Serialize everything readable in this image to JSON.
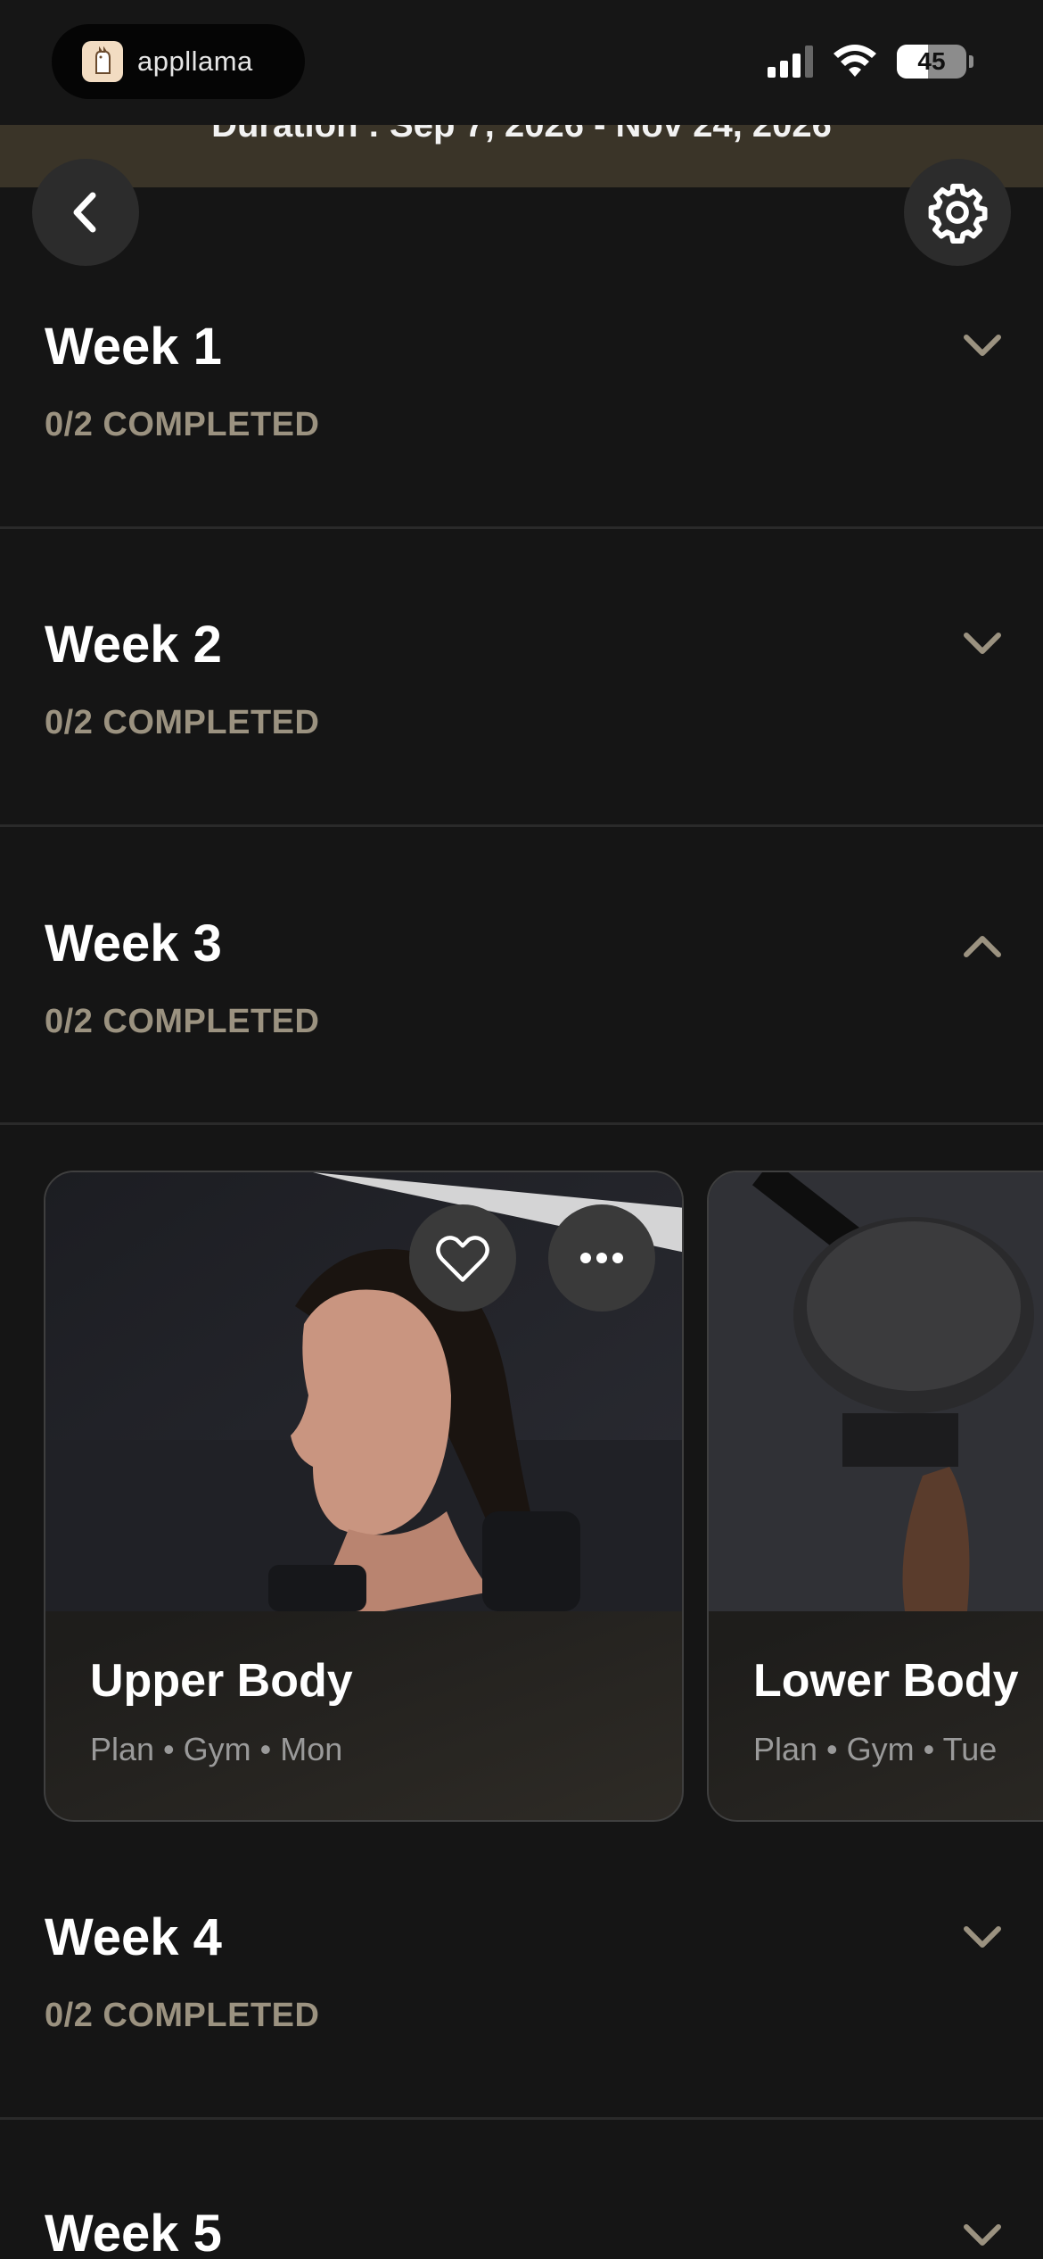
{
  "status_bar": {
    "app_name": "appllama",
    "battery": "45",
    "battery_fraction": 0.45
  },
  "header": {
    "duration": "Duration : Sep 7, 2026 - Nov 24, 2026"
  },
  "weeks": [
    {
      "title": "Week 1",
      "status": "0/2 COMPLETED",
      "expanded": false
    },
    {
      "title": "Week 2",
      "status": "0/2 COMPLETED",
      "expanded": false
    },
    {
      "title": "Week 3",
      "status": "0/2 COMPLETED",
      "expanded": true
    },
    {
      "title": "Week 4",
      "status": "0/2 COMPLETED",
      "expanded": false
    },
    {
      "title": "Week 5",
      "status": "",
      "expanded": false
    }
  ],
  "workouts": [
    {
      "title": "Upper Body",
      "meta": "Plan • Gym • Mon"
    },
    {
      "title": "Lower Body",
      "meta": "Plan • Gym • Tue"
    }
  ],
  "icons": {
    "back": "chevron-left-icon",
    "settings": "gear-icon",
    "favorite": "heart-icon",
    "more": "ellipsis-icon",
    "expand": "chevron-down-icon",
    "collapse": "chevron-up-icon"
  },
  "colors": {
    "background": "#151515",
    "accent_status": "#9b9280",
    "banner": "#3a3428"
  }
}
